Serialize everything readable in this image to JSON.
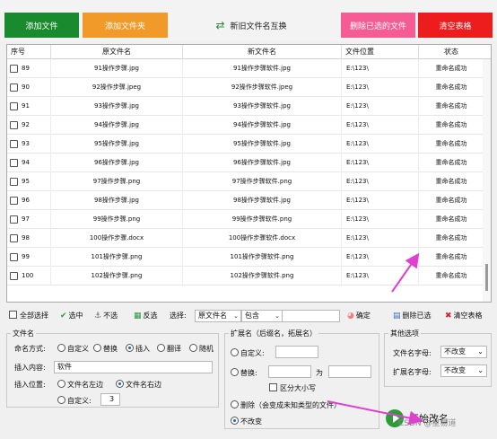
{
  "toolbar": {
    "add_file": "添加文件",
    "add_folder": "添加文件夹",
    "swap": "新旧文件名互换",
    "delete_selected": "删除已选的文件",
    "clear_table": "清空表格"
  },
  "grid": {
    "columns": [
      "序号",
      "原文件名",
      "新文件名",
      "文件位置",
      "状态"
    ],
    "rows": [
      {
        "num": "89",
        "orig": "91操作步骤.jpg",
        "new": "91操作步骤软件.jpg",
        "path": "E:\\123\\",
        "status": "重命名成功"
      },
      {
        "num": "90",
        "orig": "92操作步骤.jpeg",
        "new": "92操作步骤软件.jpeg",
        "path": "E:\\123\\",
        "status": "重命名成功"
      },
      {
        "num": "91",
        "orig": "93操作步骤.jpg",
        "new": "93操作步骤软件.jpg",
        "path": "E:\\123\\",
        "status": "重命名成功"
      },
      {
        "num": "92",
        "orig": "94操作步骤.jpg",
        "new": "94操作步骤软件.jpg",
        "path": "E:\\123\\",
        "status": "重命名成功"
      },
      {
        "num": "93",
        "orig": "95操作步骤.jpg",
        "new": "95操作步骤软件.jpg",
        "path": "E:\\123\\",
        "status": "重命名成功"
      },
      {
        "num": "94",
        "orig": "96操作步骤.jpg",
        "new": "96操作步骤软件.jpg",
        "path": "E:\\123\\",
        "status": "重命名成功"
      },
      {
        "num": "95",
        "orig": "97操作步骤.png",
        "new": "97操作步骤软件.png",
        "path": "E:\\123\\",
        "status": "重命名成功"
      },
      {
        "num": "96",
        "orig": "98操作步骤.jpg",
        "new": "98操作步骤软件.jpg",
        "path": "E:\\123\\",
        "status": "重命名成功"
      },
      {
        "num": "97",
        "orig": "99操作步骤.png",
        "new": "99操作步骤软件.png",
        "path": "E:\\123\\",
        "status": "重命名成功"
      },
      {
        "num": "98",
        "orig": "100操作步骤.docx",
        "new": "100操作步骤软件.docx",
        "path": "E:\\123\\",
        "status": "重命名成功"
      },
      {
        "num": "99",
        "orig": "101操作步骤.png",
        "new": "101操作步骤软件.png",
        "path": "E:\\123\\",
        "status": "重命名成功"
      },
      {
        "num": "100",
        "orig": "102操作步骤.png",
        "new": "102操作步骤软件.png",
        "path": "E:\\123\\",
        "status": "重命名成功"
      }
    ]
  },
  "selection": {
    "select_all": "全部选择",
    "select": "选中",
    "deselect": "不选",
    "invert": "反选",
    "select_label": "选择:",
    "field_value": "原文件名",
    "op_value": "包含",
    "confirm": "确定",
    "delete_selected": "删除已选",
    "clear_table": "清空表格"
  },
  "filename_panel": {
    "title": "文件名",
    "mode_label": "命名方式:",
    "modes": [
      "自定义",
      "替换",
      "插入",
      "翻译",
      "随机"
    ],
    "content_label": "插入内容:",
    "content_value": "软件",
    "position_label": "插入位置:",
    "pos_left": "文件名左边",
    "pos_right": "文件名右边",
    "pos_custom": "自定义:",
    "pos_custom_value": "3"
  },
  "ext_panel": {
    "title": "扩展名（后缀名，拓展名）",
    "custom": "自定义:",
    "replace": "替换:",
    "to_label": "为",
    "case_sensitive": "区分大小写",
    "delete": "删除（会变成未知类型的文件）",
    "unchanged": "不改变"
  },
  "other_panel": {
    "title": "其他选项",
    "filename_case_label": "文件名字母:",
    "filename_case_value": "不改变",
    "ext_case_label": "扩展名字母:",
    "ext_case_value": "不改变"
  },
  "start_label": "开始改名",
  "watermark": "CSDN @星易道",
  "colors": {
    "add_file": "#1a8a2e",
    "add_folder": "#f29a29",
    "delete_selected": "#f55c93",
    "clear_table": "#ee1d1d",
    "arrow": "#e040d0"
  }
}
